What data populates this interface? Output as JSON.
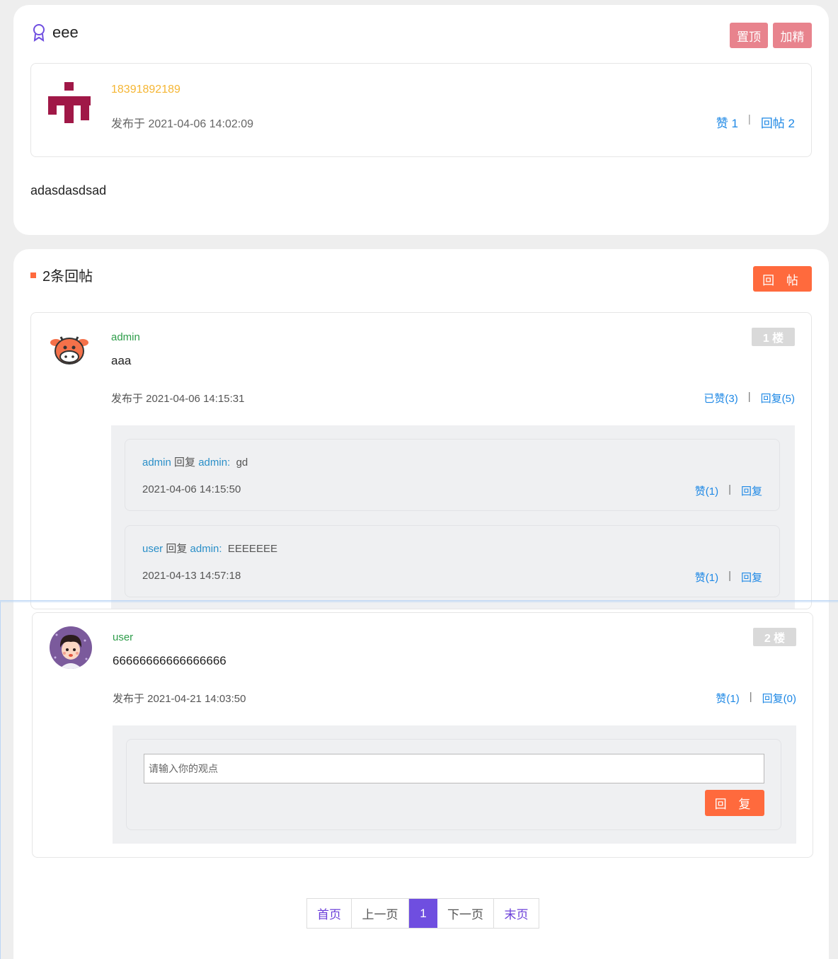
{
  "post": {
    "title": "eee",
    "btn_top": "置顶",
    "btn_essence": "加精",
    "author_phone": "18391892189",
    "published": "发布于 2021-04-06 14:02:09",
    "likes": "赞 1",
    "replies": "回帖 2",
    "sep": "|",
    "body": "adasdasdsad"
  },
  "replies_section": {
    "heading": "2条回帖",
    "reply_button": "回 帖"
  },
  "floors": [
    {
      "name": "admin",
      "content": "aaa",
      "badge": "1 楼",
      "date": "发布于 2021-04-06 14:15:31",
      "like": "已赞(3)",
      "reply": "回复(5)",
      "sub_replies": [
        {
          "user": "admin",
          "verb": "回复",
          "target": "admin:",
          "text": "gd",
          "date": "2021-04-06 14:15:50",
          "like": "赞(1)",
          "reply": "回复"
        },
        {
          "user": "user",
          "verb": "回复",
          "target": "admin:",
          "text": "EEEEEEE",
          "date": "2021-04-13 14:57:18",
          "like": "赞(1)",
          "reply": "回复"
        }
      ]
    },
    {
      "name": "user",
      "content": "66666666666666666",
      "badge": "2 楼",
      "date": "发布于 2021-04-21 14:03:50",
      "like": "赞(1)",
      "reply": "回复(0)",
      "input_placeholder": "请输入你的观点",
      "submit": "回 复"
    }
  ],
  "pagination": {
    "first": "首页",
    "prev": "上一页",
    "current": "1",
    "next": "下一页",
    "last": "末页"
  },
  "colors": {
    "accent_orange": "#ff6a3d",
    "pink_button": "#e8838d",
    "link_blue": "#1e88e5",
    "name_green": "#2e9d4a",
    "pager_purple": "#6f4ee0"
  }
}
